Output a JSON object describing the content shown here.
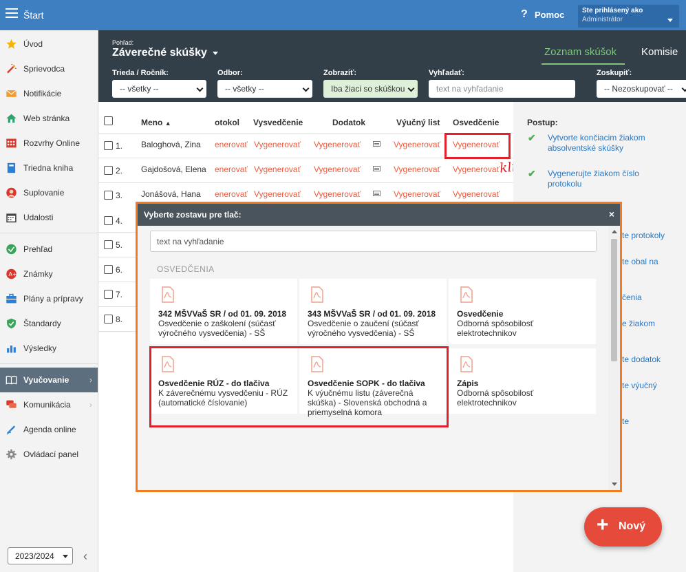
{
  "topbar": {
    "title": "Štart",
    "help": "Pomoc",
    "user_line1": "Ste prihlásený ako",
    "user_line2": "Administrátor"
  },
  "sidebar": {
    "items": [
      {
        "label": "Úvod",
        "icon": "star-icon"
      },
      {
        "label": "Sprievodca",
        "icon": "wand-icon"
      },
      {
        "label": "Notifikácie",
        "icon": "envelope-icon"
      },
      {
        "label": "Web stránka",
        "icon": "house-icon"
      },
      {
        "label": "Rozvrhy Online",
        "icon": "calendar-grid-icon"
      },
      {
        "label": "Triedna kniha",
        "icon": "book-icon"
      },
      {
        "label": "Suplovanie",
        "icon": "person-icon"
      },
      {
        "label": "Udalosti",
        "icon": "calendar-icon"
      },
      {
        "label": "Prehľad",
        "icon": "check-circle-icon"
      },
      {
        "label": "Známky",
        "icon": "grade-icon"
      },
      {
        "label": "Plány a prípravy",
        "icon": "briefcase-icon"
      },
      {
        "label": "Štandardy",
        "icon": "shield-check-icon"
      },
      {
        "label": "Výsledky",
        "icon": "bar-chart-icon"
      },
      {
        "label": "Vyučovanie",
        "icon": "open-book-icon"
      },
      {
        "label": "Komunikácia",
        "icon": "chat-icon"
      },
      {
        "label": "Agenda online",
        "icon": "pen-icon"
      },
      {
        "label": "Ovládací panel",
        "icon": "gear-icon"
      }
    ],
    "year": "2023/2024"
  },
  "header": {
    "pohlad_label": "Pohľad:",
    "view_title": "Záverečné skúšky",
    "tabs": [
      "Zoznam skúšok",
      "Komisie"
    ],
    "filters": {
      "trieda_label": "Trieda / Ročník:",
      "trieda_value": "-- všetky --",
      "odbor_label": "Odbor:",
      "odbor_value": "-- všetky --",
      "zobrazit_label": "Zobraziť:",
      "zobrazit_value": "Iba žiaci so skúškou",
      "vyhladat_label": "Vyhľadať:",
      "vyhladat_placeholder": "text na vyhľadanie",
      "zoskupit_label": "Zoskupiť:",
      "zoskupit_value": "-- Nezoskupovať --"
    }
  },
  "table": {
    "headers": [
      "Meno",
      "otokol",
      "Vysvedčenie",
      "Dodatok",
      "Výučný list",
      "Osvedčenie"
    ],
    "rows": [
      {
        "num": "1.",
        "name": "Baloghová, Zina"
      },
      {
        "num": "2.",
        "name": "Gajdošová, Elena"
      },
      {
        "num": "3.",
        "name": "Jonášová, Hana"
      },
      {
        "num": "4.",
        "name": ""
      },
      {
        "num": "5.",
        "name": ""
      },
      {
        "num": "6.",
        "name": ""
      },
      {
        "num": "7.",
        "name": ""
      },
      {
        "num": "8.",
        "name": ""
      }
    ],
    "gen_label": "Vygenerovať",
    "gen_short": "enerovať"
  },
  "annotation": {
    "klik": "klik"
  },
  "postup": {
    "title": "Postup:",
    "step1": "Vytvorte končiacim žiakom absolventské skúšky",
    "step2": "Vygenerujte žiakom číslo protokolu",
    "fragments": [
      "te protokoly",
      "te obal na",
      "čenia",
      "e žiakom",
      "te dodatok",
      "te výučný",
      "te"
    ]
  },
  "modal": {
    "title": "Vyberte zostavu pre tlač:",
    "close": "×",
    "search_placeholder": "text na vyhľadanie",
    "section": "OSVEDČENIA",
    "cards": [
      {
        "title": "342 MŠVVaŠ SR / od 01. 09. 2018",
        "desc": "Osvedčenie o zaškolení (súčasť výročného vysvedčenia) - SŠ"
      },
      {
        "title": "343 MŠVVaŠ SR / od 01. 09. 2018",
        "desc": "Osvedčenie o zaučení (súčasť výročného vysvedčenia) - SŠ"
      },
      {
        "title": "Osvedčenie",
        "desc": "Odborná spôsobilosť elektrotechnikov"
      },
      {
        "title": "Osvedčenie RÚZ - do tlačiva",
        "desc": "K záverečnému vysvedčeniu - RÚZ (automatické číslovanie)"
      },
      {
        "title": "Osvedčenie SOPK - do tlačiva",
        "desc": "K výučnému listu (záverečná skúška) - Slovenská obchodná a priemyselná komora"
      },
      {
        "title": "Zápis",
        "desc": "Odborná spôsobilosť elektrotechnikov"
      }
    ]
  },
  "fab": {
    "label": "Nový",
    "plus": "+"
  },
  "colors": {
    "topbar": "#3e7fc1",
    "header": "#323e48",
    "accent_green": "#7ec87a",
    "link_red": "#f05a3c",
    "highlight_red": "#e0202a",
    "modal_border": "#f47b20",
    "fab": "#e64a3b"
  }
}
